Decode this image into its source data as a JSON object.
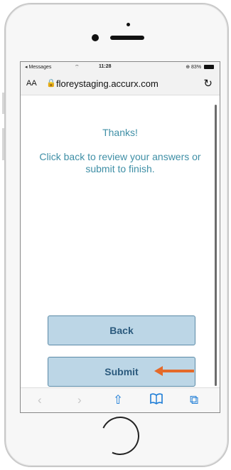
{
  "status_bar": {
    "back_app": "◂ Messages",
    "wifi": "wifi-icon",
    "time": "11:28",
    "battery": "⊕ 83%"
  },
  "url_bar": {
    "aa": "AA",
    "lock_icon": "lock-icon",
    "url": "floreystaging.accurx.com",
    "reload_icon": "reload-icon"
  },
  "main": {
    "heading": "Thanks!",
    "message": "Click back to review your answers or submit to finish."
  },
  "buttons": {
    "back": "Back",
    "submit": "Submit"
  },
  "annotation": {
    "arrow_color": "#e46a2a"
  },
  "toolbar": {
    "back_icon": "‹",
    "forward_icon": "›",
    "share_icon": "⇧",
    "bookmarks_icon": "📖",
    "tabs_icon": "⧉"
  },
  "colors": {
    "accent_text": "#3f8fa6",
    "button_bg": "#bcd6e6",
    "button_border": "#5b8aa6",
    "button_text": "#2b5a7d",
    "ios_blue": "#1c7cd6"
  }
}
